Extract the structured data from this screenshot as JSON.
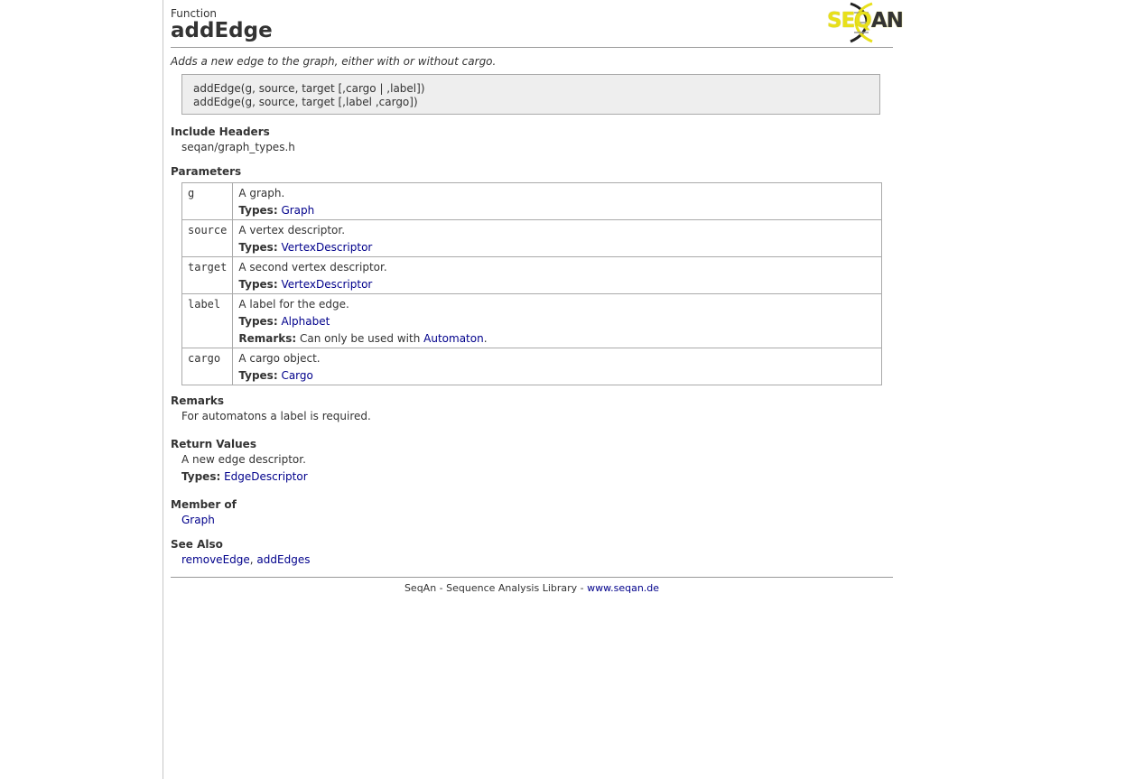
{
  "header": {
    "kind": "Function",
    "title": "addEdge",
    "logo_text_seq": "SEQ",
    "logo_text_an": "AN"
  },
  "summary": "Adds a new edge to the graph, either with or without cargo.",
  "signatures": [
    "addEdge(g, source, target [,cargo | ,label])",
    "addEdge(g, source, target [,label ,cargo])"
  ],
  "include_headers": {
    "heading": "Include Headers",
    "value": "seqan/graph_types.h"
  },
  "parameters": {
    "heading": "Parameters",
    "rows": [
      {
        "name": "g",
        "desc": "A graph.",
        "types_label": "Types:",
        "types": "Graph"
      },
      {
        "name": "source",
        "desc": "A vertex descriptor.",
        "types_label": "Types:",
        "types": "VertexDescriptor"
      },
      {
        "name": "target",
        "desc": "A second vertex descriptor.",
        "types_label": "Types:",
        "types": "VertexDescriptor"
      },
      {
        "name": "label",
        "desc": "A label for the edge.",
        "types_label": "Types:",
        "types": "Alphabet",
        "remarks_label": "Remarks:",
        "remarks_text": "Can only be used with",
        "remarks_link": "Automaton",
        "remarks_end": "."
      },
      {
        "name": "cargo",
        "desc": "A cargo object.",
        "types_label": "Types:",
        "types": "Cargo"
      }
    ]
  },
  "remarks": {
    "heading": "Remarks",
    "text": "For automatons a label is required."
  },
  "return_values": {
    "heading": "Return Values",
    "text": "A new edge descriptor.",
    "types_label": "Types:",
    "types": "EdgeDescriptor"
  },
  "member_of": {
    "heading": "Member of",
    "link": "Graph"
  },
  "see_also": {
    "heading": "See Also",
    "link1": "removeEdge",
    "sep": ", ",
    "link2": "addEdges"
  },
  "footer": {
    "text": "SeqAn - Sequence Analysis Library - ",
    "link": "www.seqan.de"
  }
}
